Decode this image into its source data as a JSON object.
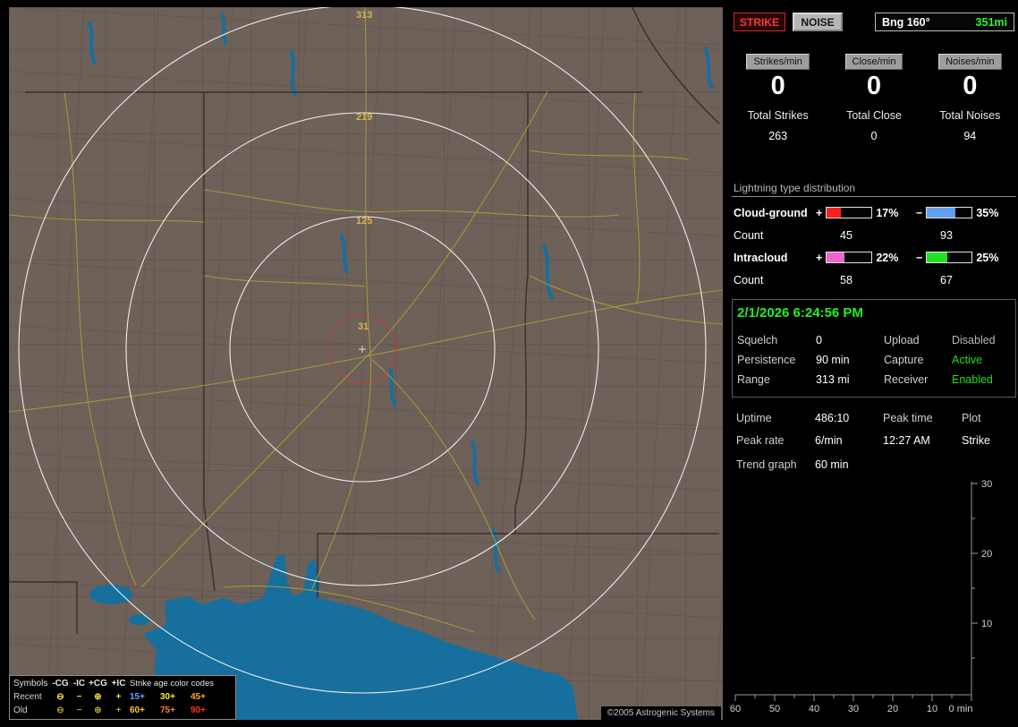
{
  "map": {
    "range_labels": {
      "r1": "313",
      "r2": "219",
      "r3": "125",
      "r4": "31"
    },
    "copyright": "©2005 Astrogenic Systems",
    "range_circle_color": "#ececec",
    "alert_circle_color": "#e23030"
  },
  "legend": {
    "header": {
      "symbols": "Symbols",
      "cg_neg": "-CG",
      "ic_neg": "-IC",
      "cg_pos": "+CG",
      "ic_pos": "+IC",
      "age": "Strike age color codes"
    },
    "recent": {
      "label": "Recent",
      "s1": "⊖",
      "s2": "−",
      "s3": "⊕",
      "s4": "+",
      "sym_color": "#f2e13a",
      "a1": "15+",
      "a1c": "#55aaff",
      "a2": "30+",
      "a2c": "#ffee33",
      "a3": "45+",
      "a3c": "#ffaa22"
    },
    "old": {
      "label": "Old",
      "s1": "⊖",
      "s2": "−",
      "s3": "⊕",
      "s4": "+",
      "sym_color": "#b0a22e",
      "a1": "60+",
      "a1c": "#ffc832",
      "a2": "75+",
      "a2c": "#ff8030",
      "a3": "90+",
      "a3c": "#ff3322"
    }
  },
  "panel": {
    "toolbar": {
      "strike": "STRIKE",
      "noise": "NOISE",
      "bearing_label": "Bng 160°",
      "bearing_value": "351mi"
    },
    "rates": [
      {
        "header": "Strikes/min",
        "value": "0",
        "total_label": "Total Strikes",
        "total": "263"
      },
      {
        "header": "Close/min",
        "value": "0",
        "total_label": "Total Close",
        "total": "0"
      },
      {
        "header": "Noises/min",
        "value": "0",
        "total_label": "Total Noises",
        "total": "94"
      }
    ],
    "distribution": {
      "title": "Lightning type distribution",
      "rows": [
        {
          "label": "Cloud-ground",
          "pos_sign": "+",
          "pos_pct": "17%",
          "pos_value": 17,
          "pos_color": "#ff1e1e",
          "neg_sign": "−",
          "neg_pct": "35%",
          "neg_value": 35,
          "neg_color": "#5e9fee",
          "count_label": "Count",
          "pos_count": "45",
          "neg_count": "93"
        },
        {
          "label": "Intracloud",
          "pos_sign": "+",
          "pos_pct": "22%",
          "pos_value": 22,
          "pos_color": "#ee66cc",
          "neg_sign": "−",
          "neg_pct": "25%",
          "neg_value": 25,
          "neg_color": "#22e022",
          "count_label": "Count",
          "pos_count": "58",
          "neg_count": "67"
        }
      ]
    },
    "status": {
      "datetime": "2/1/2026 6:24:56 PM",
      "datetime_color": "#22ee22",
      "rows": [
        {
          "k1": "Squelch",
          "v1": "0",
          "k2": "Upload",
          "v2": "Disabled",
          "v2_color": "#b8b8b8"
        },
        {
          "k1": "Persistence",
          "v1": "90 min",
          "k2": "Capture",
          "v2": "Active",
          "v2_color": "#22dd22"
        },
        {
          "k1": "Range",
          "v1": "313 mi",
          "k2": "Receiver",
          "v2": "Enabled",
          "v2_color": "#22dd22"
        }
      ]
    },
    "stats2": {
      "rows": [
        {
          "c1": "Uptime",
          "c2": "486:10",
          "c3": "Peak time",
          "c4": "Plot"
        },
        {
          "c1": "Peak rate",
          "c2": "6/min",
          "c3": "12:27 AM",
          "c4": "Strike"
        }
      ],
      "trend_label": "Trend graph",
      "trend_value": "60 min"
    },
    "chart": {
      "type": "line",
      "y_ticks": {
        "t30": "30",
        "t20": "20",
        "t10": "10"
      },
      "x_ticks": {
        "t60": "60",
        "t50": "50",
        "t40": "40",
        "t30": "30",
        "t20": "20",
        "t10": "10",
        "t0": "0 min"
      },
      "y_range": [
        0,
        30
      ],
      "x_range_min": [
        60,
        0
      ],
      "series_values": []
    }
  }
}
